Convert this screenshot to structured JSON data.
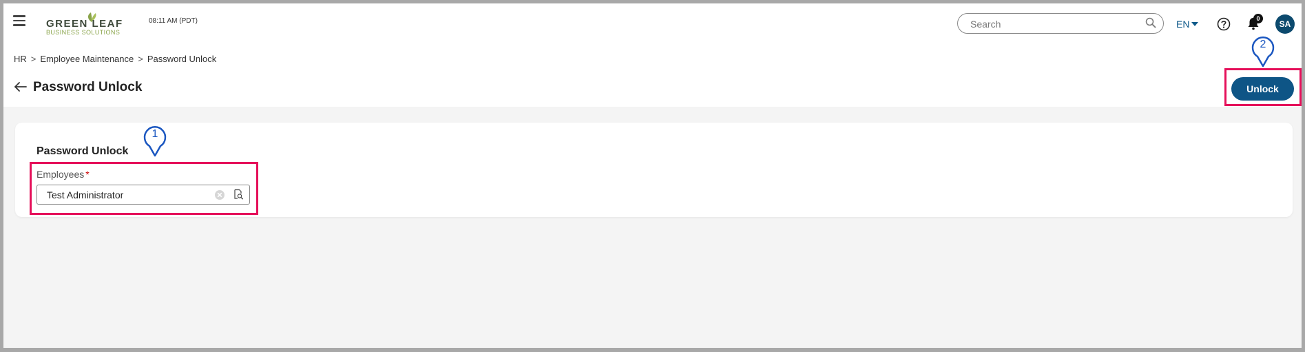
{
  "header": {
    "logo_top": "GREEN LEAF",
    "logo_bottom": "BUSINESS SOLUTIONS",
    "time": "08:11 AM (PDT)",
    "search_placeholder": "Search",
    "language": "EN",
    "notification_count": "0",
    "avatar_initials": "SA"
  },
  "breadcrumb": {
    "items": [
      "HR",
      "Employee Maintenance",
      "Password Unlock"
    ],
    "separator": ">"
  },
  "page": {
    "title": "Password Unlock",
    "primary_button": "Unlock"
  },
  "card": {
    "title": "Password Unlock",
    "field_label": "Employees",
    "required_mark": "*",
    "field_value": "Test Administrator"
  },
  "annotations": {
    "marker_1": "1",
    "marker_2": "2"
  },
  "colors": {
    "primary": "#0e5586",
    "highlight": "#e5105a",
    "marker": "#1a56c0",
    "logo_green": "#8aa44a"
  }
}
